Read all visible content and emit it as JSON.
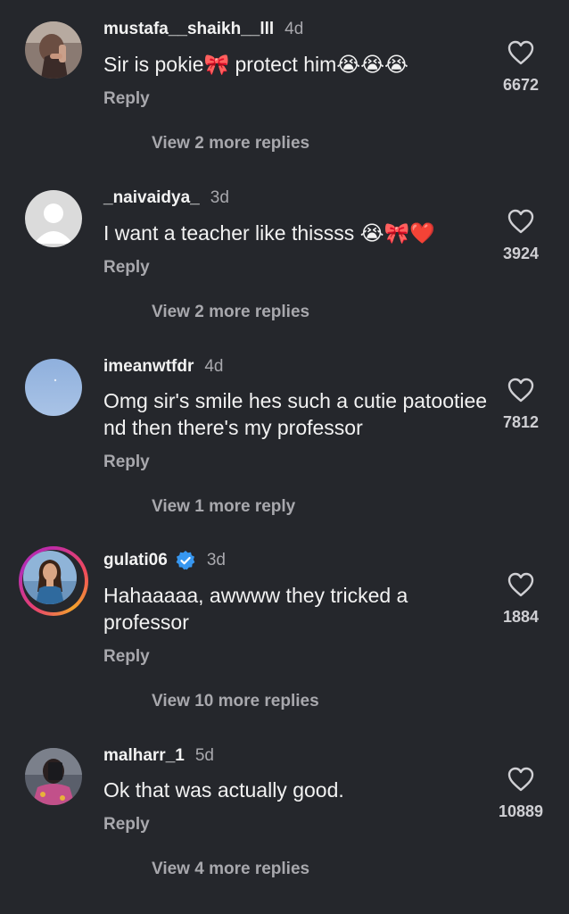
{
  "comments": [
    {
      "username": "mustafa__shaikh__lll",
      "time": "4d",
      "text": "Sir is pokie🎀 protect him😭😭😭",
      "reply_label": "Reply",
      "more_replies": "View 2 more replies",
      "likes": "6672",
      "avatar_icon": "profile-photo-hand",
      "verified": false
    },
    {
      "username": "_naivaidya_",
      "time": "3d",
      "text": "I want a teacher like thissss 😭🎀❤️",
      "reply_label": "Reply",
      "more_replies": "View 2 more replies",
      "likes": "3924",
      "avatar_icon": "default-avatar",
      "verified": false
    },
    {
      "username": "imeanwtfdr",
      "time": "4d",
      "text": "Omg sir's smile hes such a cutie patootiee nd then there's my professor",
      "reply_label": "Reply",
      "more_replies": "View 1 more reply",
      "likes": "7812",
      "avatar_icon": "sky-photo",
      "verified": false
    },
    {
      "username": "gulati06",
      "time": "3d",
      "text": "Hahaaaaa,  awwww they tricked a professor",
      "reply_label": "Reply",
      "more_replies": "View 10 more replies",
      "likes": "1884",
      "avatar_icon": "woman-portrait",
      "verified": true
    },
    {
      "username": "malharr_1",
      "time": "5d",
      "text": "Ok that was actually good.",
      "reply_label": "Reply",
      "more_replies": "View 4 more replies",
      "likes": "10889",
      "avatar_icon": "mirror-selfie",
      "verified": false
    }
  ],
  "colors": {
    "background": "#25272c",
    "primary_text": "#f2f2f2",
    "secondary_text": "#a8a8ad",
    "verified_blue": "#3797f0"
  }
}
